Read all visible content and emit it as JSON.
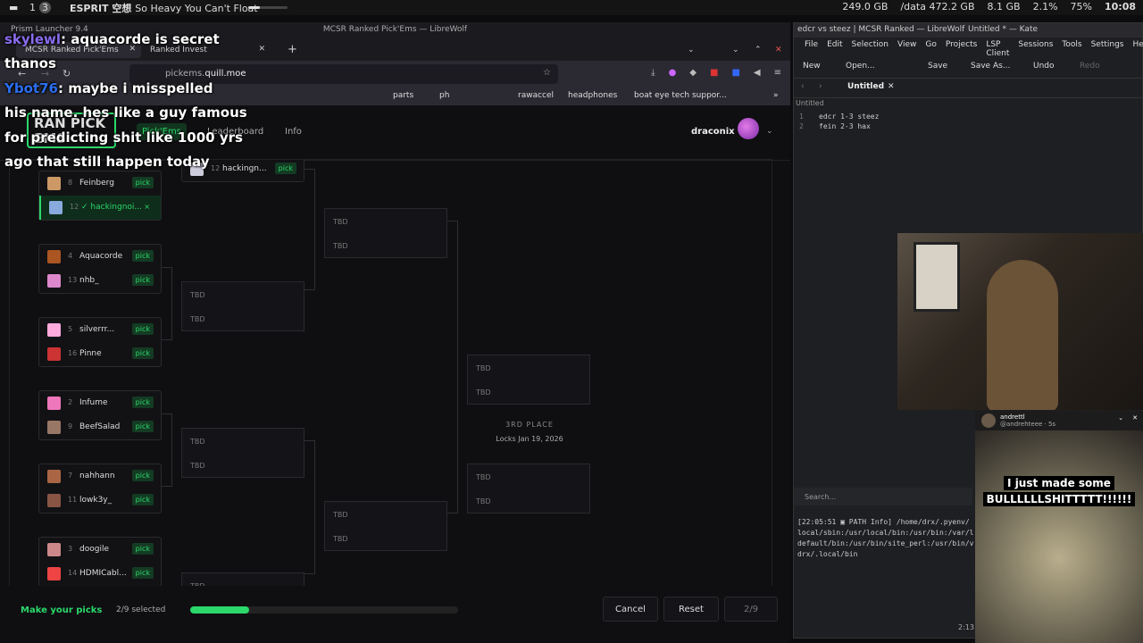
{
  "topbar": {
    "workspace1": "1",
    "workspace2": "3",
    "song_artist": "ESPRIT 空想",
    "song_title": "So Heavy You Can't Float",
    "disk1": "249.0 GB",
    "disk2": "/data 472.2 GB",
    "ram": "8.1 GB",
    "cpu": "2.1%",
    "volume": "75%",
    "clock": "10:08",
    "volume_level": 0.3
  },
  "browser": {
    "window_title": "MCSR Ranked Pick'Ems — LibreWolf",
    "left_title": "Prism Launcher 9.4",
    "tabs": [
      {
        "label": "MCSR Ranked Pick'Ems"
      },
      {
        "label": "Ranked Invest"
      }
    ],
    "url_prefix": "pickems.",
    "url_domain": "quill.moe",
    "bookmarks": [
      "parts",
      "ph",
      "rawaccel",
      "headphones",
      "boat eye tech suppor..."
    ]
  },
  "page": {
    "logo": "RAN PICK EMS",
    "nav": [
      "Pick'Ems",
      "Leaderboard",
      "Info"
    ],
    "username": "draconix",
    "round1": [
      {
        "top": {
          "seed": "8",
          "name": "Feinberg",
          "pick": "pick"
        },
        "bottom": {
          "seed": "12",
          "name": "✓ hackingnoi...",
          "pick": "×",
          "won": true
        }
      },
      {
        "top": {
          "seed": "4",
          "name": "Aquacorde",
          "pick": "pick"
        },
        "bottom": {
          "seed": "13",
          "name": "nhb_",
          "pick": "pick"
        }
      },
      {
        "top": {
          "seed": "5",
          "name": "silverrr...",
          "pick": "pick"
        },
        "bottom": {
          "seed": "16",
          "name": "Pinne",
          "pick": "pick"
        }
      },
      {
        "top": {
          "seed": "2",
          "name": "Infume",
          "pick": "pick"
        },
        "bottom": {
          "seed": "9",
          "name": "BeefSalad",
          "pick": "pick"
        }
      },
      {
        "top": {
          "seed": "7",
          "name": "nahhann",
          "pick": "pick"
        },
        "bottom": {
          "seed": "11",
          "name": "lowk3y_",
          "pick": "pick"
        }
      },
      {
        "top": {
          "seed": "3",
          "name": "doogile",
          "pick": "pick"
        },
        "bottom": {
          "seed": "14",
          "name": "HDMICabl...",
          "pick": "pick"
        }
      }
    ],
    "round2_top": {
      "seed": "12",
      "name": "hackingn...",
      "pick": "pick"
    },
    "tbd": "TBD",
    "third_place": "3RD PLACE",
    "locks": "Locks Jan 19, 2026",
    "footer": {
      "make_picks": "Make your picks",
      "selected": "2/9 selected",
      "progress": 0.22,
      "cancel": "Cancel",
      "reset": "Reset",
      "submit": "2/9"
    }
  },
  "chat": [
    {
      "user": "skylewl",
      "text": "aquacorde is secret"
    },
    {
      "text": "thanos"
    },
    {
      "user": "Ybot76",
      "text": "maybe i misspelled"
    },
    {
      "text": "his name. hes like a guy famous"
    },
    {
      "text": "for predicting shit like 1000 yrs"
    },
    {
      "text": "ago that still happen today"
    }
  ],
  "kate": {
    "title": "edcr vs steez | MCSR Ranked — LibreWolf",
    "title_right": "Untitled * — Kate",
    "menu": [
      "File",
      "Edit",
      "Selection",
      "View",
      "Go",
      "Projects",
      "LSP Client",
      "Sessions",
      "Tools",
      "Settings",
      "Help"
    ],
    "toolbar": [
      "New",
      "Open...",
      "Save",
      "Save As...",
      "Undo",
      "Redo"
    ],
    "tab": "Untitled",
    "breadcrumb": "Untitled",
    "lines": [
      {
        "n": "1",
        "code": "edcr 1-3 steez"
      },
      {
        "n": "2",
        "code": "fein 2-3 hax"
      }
    ],
    "search": "Search...",
    "terminal": [
      "[22:05:51 ▣ PATH Info] /home/drx/.pyenv/",
      "local/sbin:/usr/local/bin:/usr/bin:/var/l",
      "default/bin:/usr/bin/site_perl:/usr/bin/v",
      "drx/.local/bin"
    ],
    "timestamp": "2:13"
  },
  "popup": {
    "name": "andrettl",
    "handle": "@andrehteee · 5s",
    "caption1": "I just made some",
    "caption2": "BULLLLLLSHITTTTT!!!!!!"
  }
}
